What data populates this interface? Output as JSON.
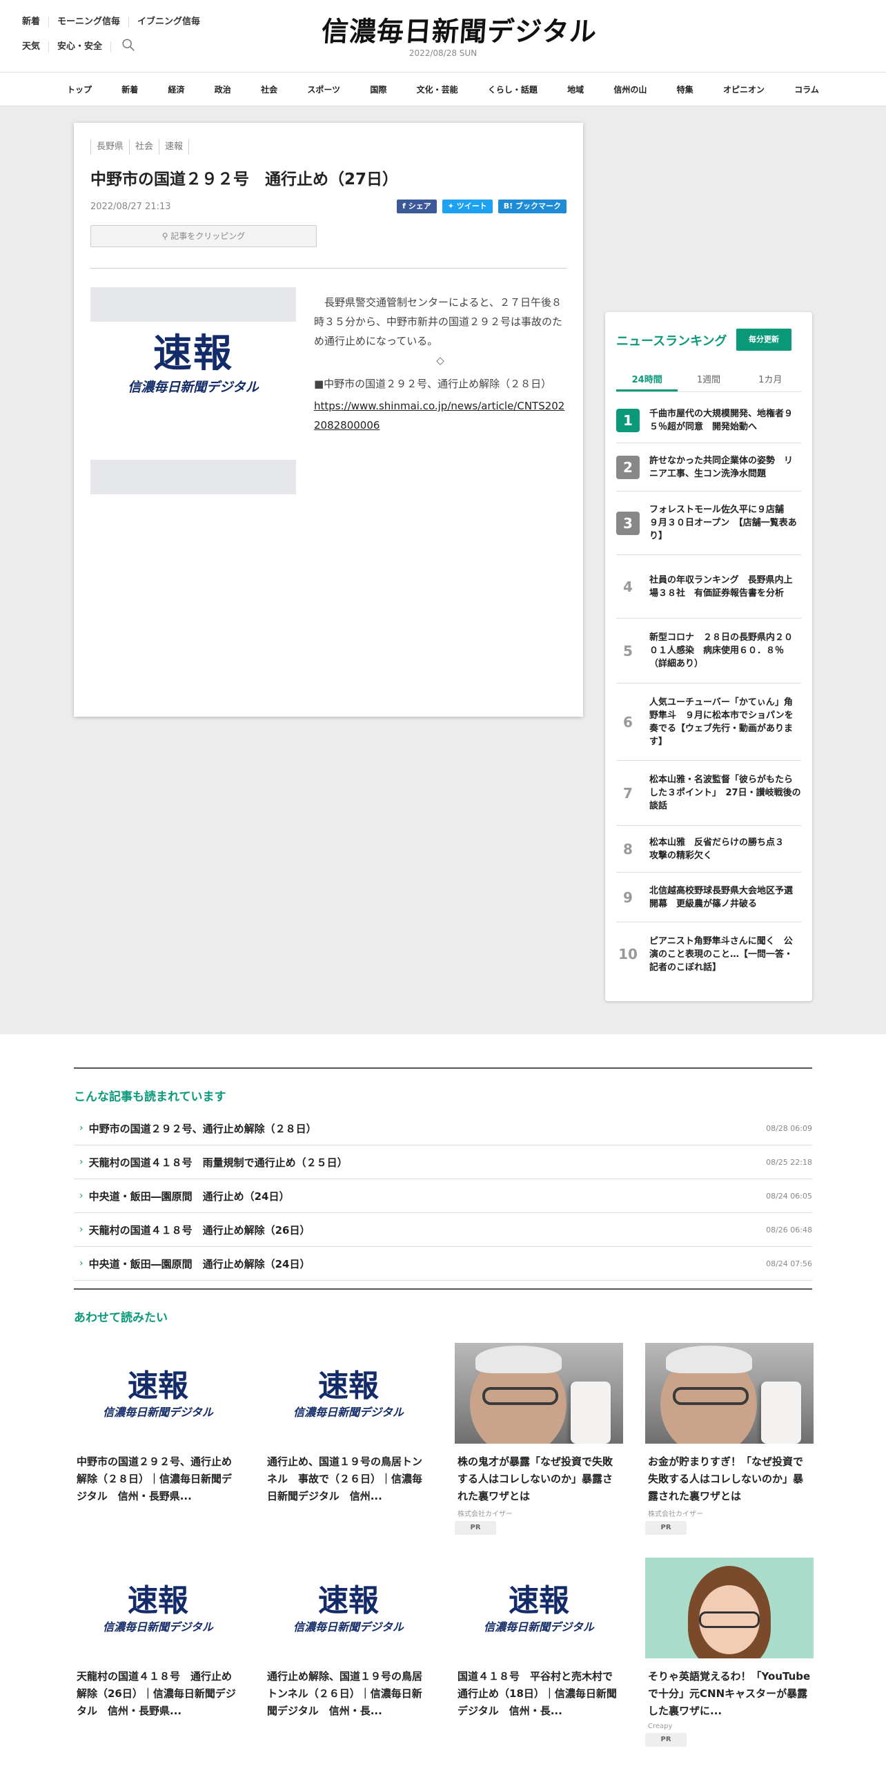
{
  "header": {
    "links_row1": [
      "新着",
      "モーニング信毎",
      "イブニング信毎"
    ],
    "links_row2": [
      "天気",
      "安心・安全"
    ],
    "logo": "信濃毎日新聞デジタル",
    "date": "2022/08/28 SUN"
  },
  "nav": [
    "トップ",
    "新着",
    "経済",
    "政治",
    "社会",
    "スポーツ",
    "国際",
    "文化・芸能",
    "くらし・話題",
    "地域",
    "信州の山",
    "特集",
    "オピニオン",
    "コラム"
  ],
  "article": {
    "tags": [
      "長野県",
      "社会",
      "速報"
    ],
    "title": "中野市の国道２９２号　通行止め（27日）",
    "date": "2022/08/27 21:13",
    "share": {
      "facebook": "シェア",
      "twitter": "ツイート",
      "bookmark": "ブックマーク"
    },
    "clip": "記事をクリッピング",
    "image": {
      "big": "速報",
      "sub": "信濃毎日新聞デジタル"
    },
    "body1": "　長野県警交通管制センターによると、２７日午後８時３５分から、中野市新井の国道２９２号は事故のため通行止めになっている。",
    "diamond": "◇",
    "body2": "■中野市の国道２９２号、通行止め解除（２８日）",
    "link": "https://www.shinmai.co.jp/news/article/CNTS2022082800006"
  },
  "ranking": {
    "title": "ニュースランキング",
    "badge": "毎分更新",
    "tabs": [
      "24時間",
      "1週間",
      "1カ月"
    ],
    "items": [
      {
        "num": "1",
        "text": "千曲市屋代の大規模開発、地権者９５％超が同意　開発始動へ"
      },
      {
        "num": "2",
        "text": "許せなかった共同企業体の姿勢　リニア工事、生コン洗浄水問題"
      },
      {
        "num": "3",
        "text": "フォレストモール佐久平に９店舗　９月３０日オープン　【店舗一覧表あり】"
      },
      {
        "num": "4",
        "text": "社員の年収ランキング　長野県内上場３８社　有価証券報告書を分析"
      },
      {
        "num": "5",
        "text": "新型コロナ　２８日の長野県内２００１人感染　病床使用６０．８％（詳細あり）"
      },
      {
        "num": "6",
        "text": "人気ユーチューバー「かてぃん」角野隼斗　９月に松本市でショパンを奏でる【ウェブ先行・動画があります】"
      },
      {
        "num": "7",
        "text": "松本山雅・名波監督「彼らがもたらした３ポイント」　27日・讃岐戦後の談話"
      },
      {
        "num": "8",
        "text": "松本山雅　反省だらけの勝ち点３　攻撃の精彩欠く"
      },
      {
        "num": "9",
        "text": "北信越高校野球長野県大会地区予選開幕　更級農が篠ノ井破る"
      },
      {
        "num": "10",
        "text": "ピアニスト角野隼斗さんに聞く　公演のこと表現のこと…【一問一答・記者のこぼれ話】"
      }
    ]
  },
  "related": {
    "title": "こんな記事も読まれています",
    "items": [
      {
        "title": "中野市の国道２９２号、通行止め解除（２８日）",
        "date": "08/28 06:09"
      },
      {
        "title": "天龍村の国道４１８号　雨量規制で通行止め（２５日）",
        "date": "08/25 22:18"
      },
      {
        "title": "中央道・飯田―園原間　通行止め（24日）",
        "date": "08/24 06:05"
      },
      {
        "title": "天龍村の国道４１８号　通行止め解除（26日）",
        "date": "08/26 06:48"
      },
      {
        "title": "中央道・飯田―園原間　通行止め解除（24日）",
        "date": "08/24 07:56"
      }
    ]
  },
  "recommend": {
    "title": "あわせて読みたい",
    "row1": [
      {
        "kind": "soku",
        "title": "中野市の国道２９２号、通行止め解除（２８日）｜信濃毎日新聞デジタル　信州・長野県..."
      },
      {
        "kind": "soku",
        "title": "通行止め、国道１９号の鳥居トンネル　事故で（２６日）｜信濃毎日新聞デジタル　信州..."
      },
      {
        "kind": "man",
        "title": "株の鬼才が暴露「なぜ投資で失敗する人はコレしないのか」暴露された裏ワザとは",
        "sponsor": "株式会社カイザー",
        "pr": "PR"
      },
      {
        "kind": "man",
        "title": "お金が貯まりすぎ！「なぜ投資で失敗する人はコレしないのか」暴露された裏ワザとは",
        "sponsor": "株式会社カイザー",
        "pr": "PR"
      }
    ],
    "row2": [
      {
        "kind": "soku",
        "title": "天龍村の国道４１８号　通行止め解除（26日）｜信濃毎日新聞デジタル　信州・長野県..."
      },
      {
        "kind": "soku",
        "title": "通行止め解除、国道１９号の鳥居トンネル（２６日）｜信濃毎日新聞デジタル　信州・長..."
      },
      {
        "kind": "soku",
        "title": "国道４１８号　平谷村と売木村で通行止め（18日）｜信濃毎日新聞デジタル　信州・長..."
      },
      {
        "kind": "woman",
        "title": "そりゃ英語覚えるわ！「YouTubeで十分」元CNNキャスターが暴露した裏ワザに...",
        "sponsor": "Creapy",
        "pr": "PR"
      }
    ],
    "soku_big": "速報",
    "soku_sub": "信濃毎日新聞デジタル"
  }
}
